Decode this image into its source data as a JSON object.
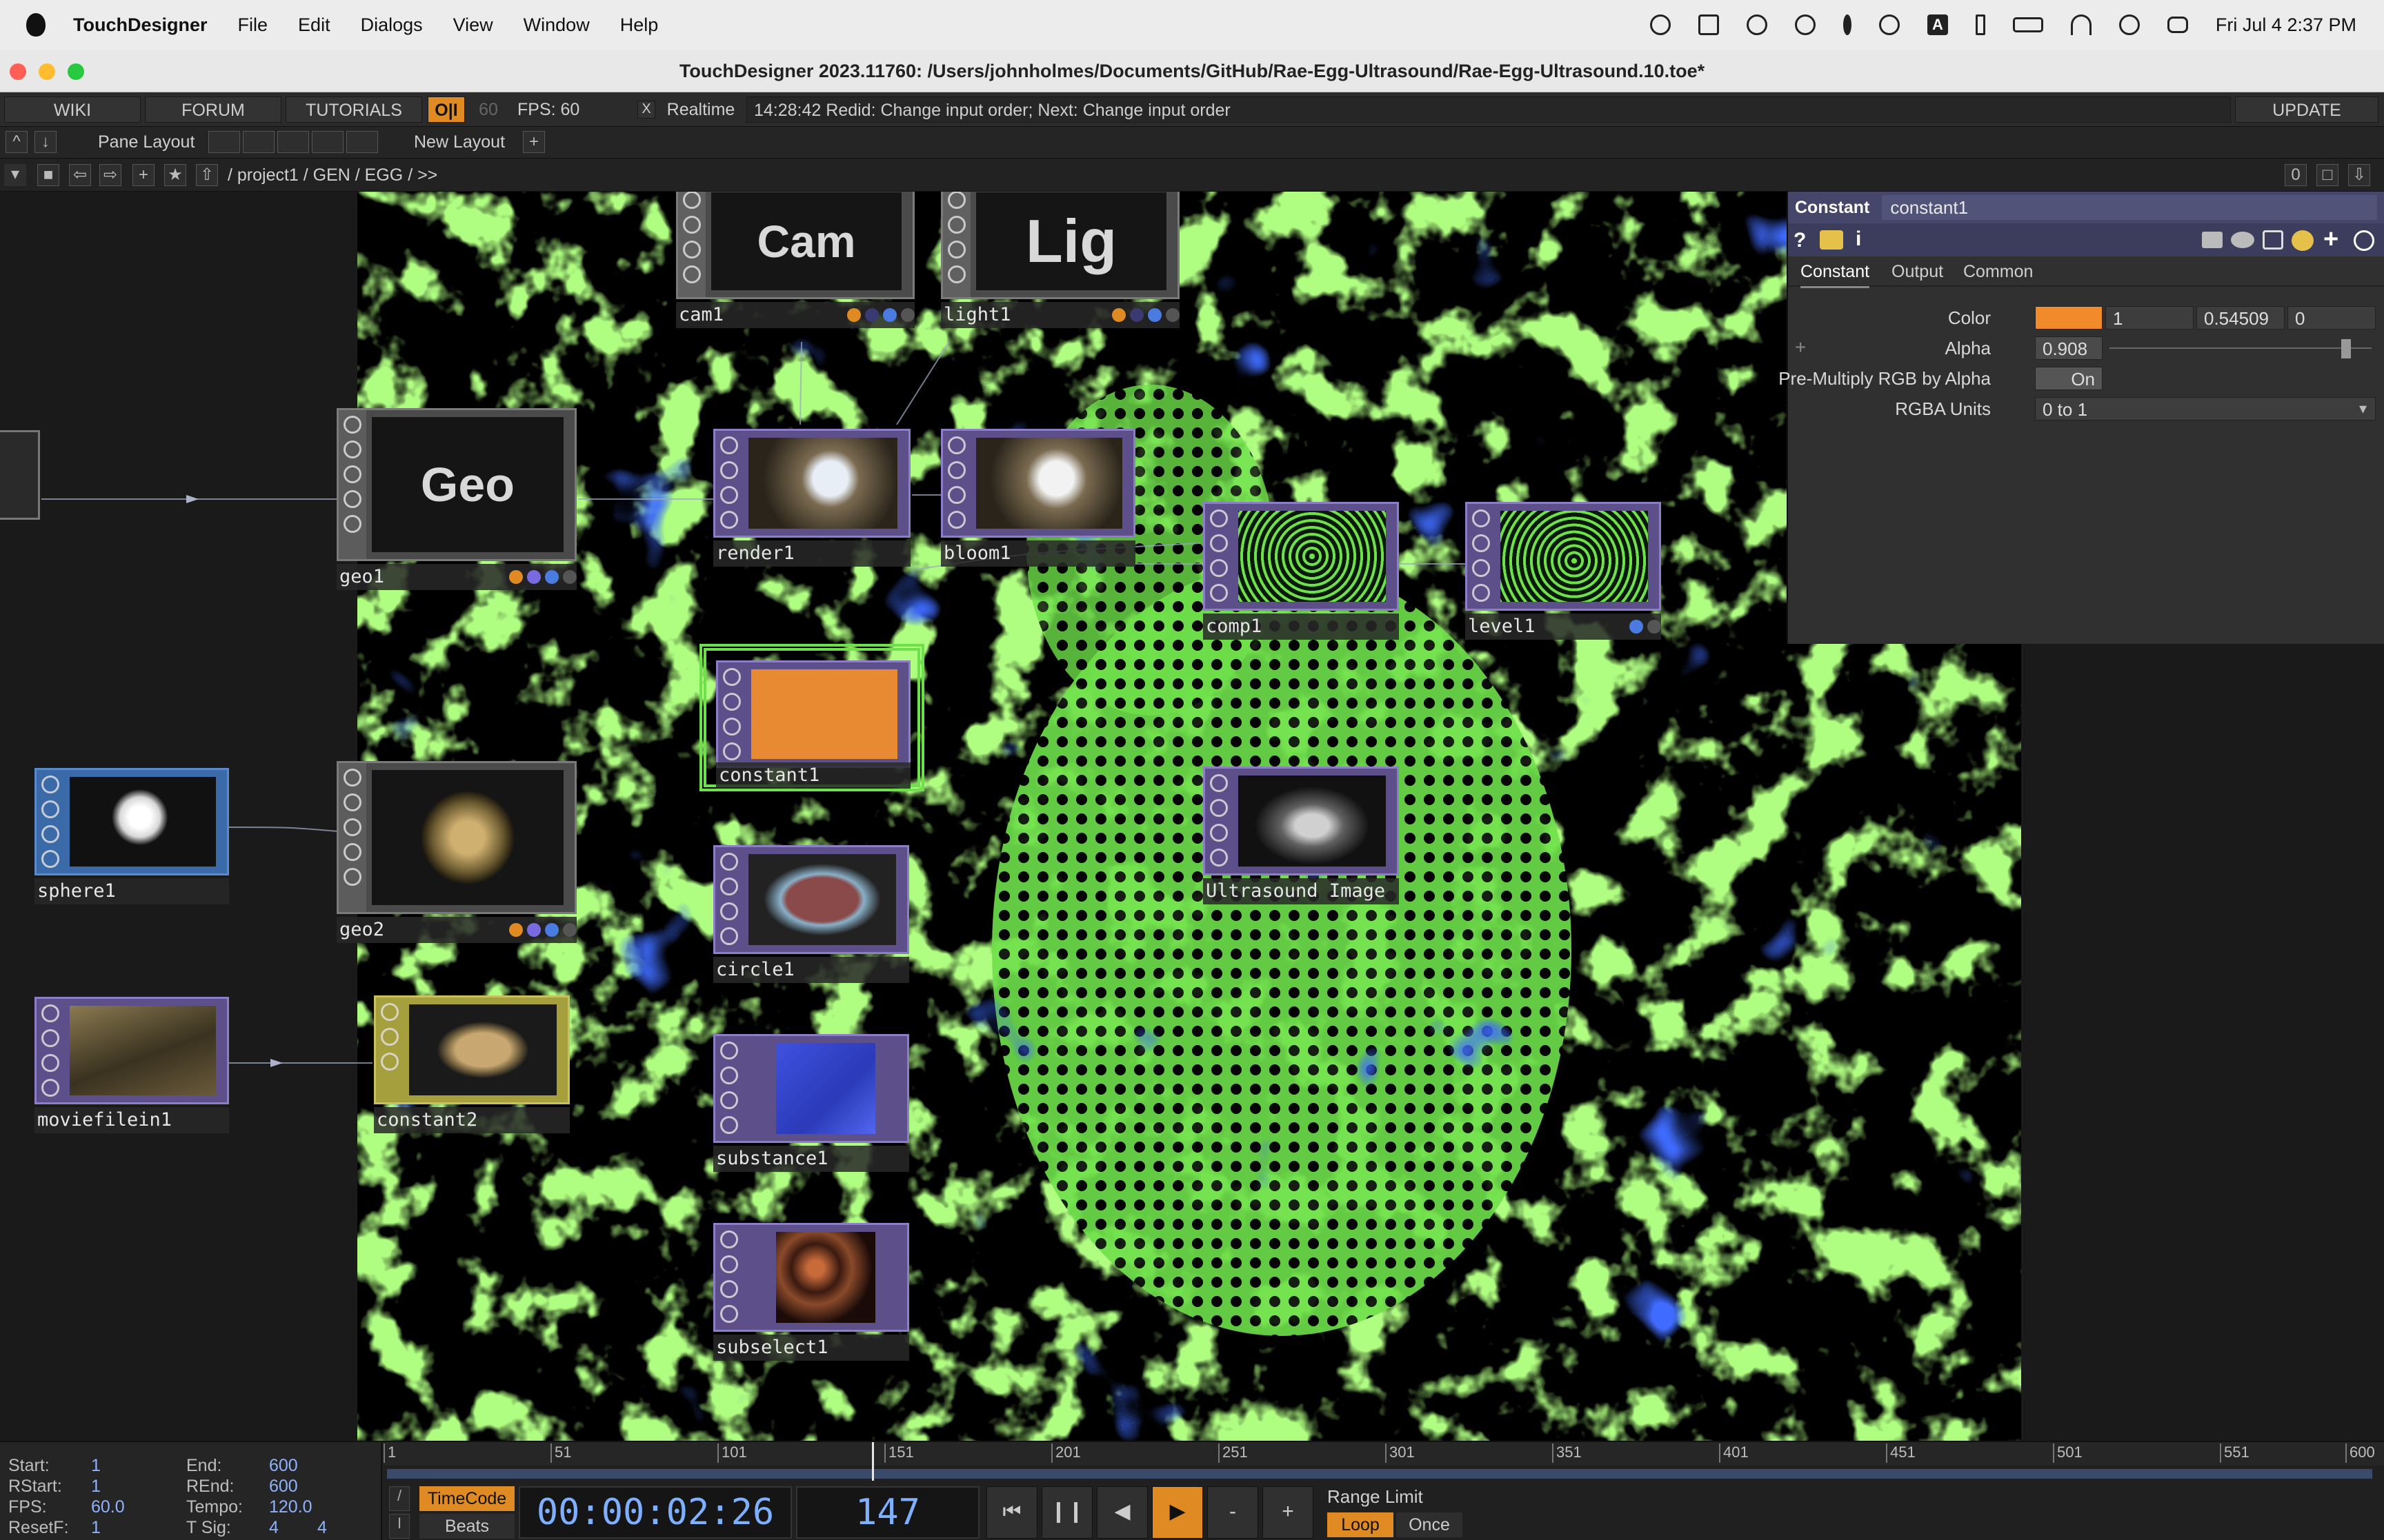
{
  "menubar": {
    "app": "TouchDesigner",
    "items": [
      "File",
      "Edit",
      "Dialogs",
      "View",
      "Window",
      "Help"
    ],
    "input_source": "A",
    "clock": "Fri Jul 4  2:37 PM"
  },
  "window": {
    "title": "TouchDesigner 2023.11760: /Users/johnholmes/Documents/GitHub/Rae-Egg-Ultrasound/Rae-Egg-Ultrasound.10.toe*"
  },
  "toolbar": {
    "wiki": "WIKI",
    "forum": "FORUM",
    "tutorials": "TUTORIALS",
    "oi": "O|I",
    "fps_target": "60",
    "fps_label": "FPS:  60",
    "realtime_check": "X",
    "realtime": "Realtime",
    "status": "14:28:42 Redid: Change input order; Next: Change input order",
    "update": "UPDATE",
    "pane_layout": "Pane Layout",
    "new_layout": "New Layout",
    "path": "/ project1 / GEN / EGG / >>",
    "pane_index": "0"
  },
  "nodes": {
    "cam1": {
      "label": "cam1",
      "text": "Cam"
    },
    "light1": {
      "label": "light1",
      "text": "Lig"
    },
    "geo1": {
      "label": "geo1",
      "text": "Geo"
    },
    "render1": {
      "label": "render1"
    },
    "bloom1": {
      "label": "bloom1"
    },
    "comp1": {
      "label": "comp1"
    },
    "level1": {
      "label": "level1"
    },
    "constant1": {
      "label": "constant1"
    },
    "sphere1": {
      "label": "sphere1"
    },
    "geo2": {
      "label": "geo2"
    },
    "circle1": {
      "label": "circle1"
    },
    "ultrasound": {
      "label": "Ultrasound Image"
    },
    "moviefilein1": {
      "label": "moviefilein1"
    },
    "constant2": {
      "label": "constant2"
    },
    "substance1": {
      "label": "substance1"
    },
    "subselect1": {
      "label": "subselect1"
    }
  },
  "params": {
    "op_type": "Constant",
    "op_name": "constant1",
    "tabs": [
      "Constant",
      "Output",
      "Common"
    ],
    "color_label": "Color",
    "color_r": "1",
    "color_g": "0.54509",
    "color_b": "0",
    "color_swatch": "#f08a2a",
    "alpha_label": "Alpha",
    "alpha_value": "0.908",
    "premult_label": "Pre-Multiply RGB by Alpha",
    "premult_value": "On",
    "rgba_units_label": "RGBA Units",
    "rgba_units_value": "0 to 1"
  },
  "timeline": {
    "start_label": "Start:",
    "start": "1",
    "end_label": "End:",
    "end": "600",
    "rstart_label": "RStart:",
    "rstart": "1",
    "rend_label": "REnd:",
    "rend": "600",
    "fps_label": "FPS:",
    "fps": "60.0",
    "tempo_label": "Tempo:",
    "tempo": "120.0",
    "resetf_label": "ResetF:",
    "resetf": "1",
    "tsig_label": "T Sig:",
    "tsig_a": "4",
    "tsig_b": "4",
    "ticks": [
      "1",
      "51",
      "101",
      "151",
      "201",
      "251",
      "301",
      "351",
      "401",
      "451",
      "501",
      "551",
      "600"
    ],
    "mode_timecode": "TimeCode",
    "mode_beats": "Beats",
    "timecode": "00:00:02:26",
    "frame": "147",
    "range_limit": "Range Limit",
    "loop": "Loop",
    "once": "Once",
    "minus": "-",
    "plus": "+"
  },
  "colors": {
    "top_purple": "#7b6aa8",
    "comp_green": "#6ee04a",
    "geo_gray": "#7a7a7a",
    "sop_blue": "#4f7fb8",
    "mat_yellow": "#b5ad46",
    "accent_orange": "#f08a2a"
  }
}
